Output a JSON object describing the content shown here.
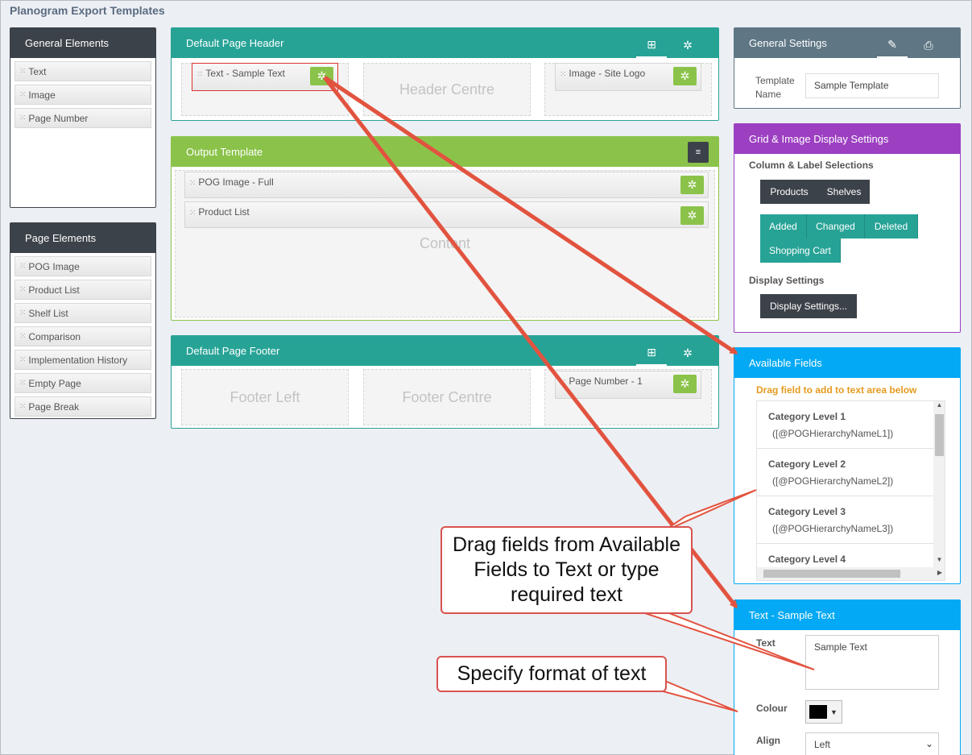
{
  "page_title": "Planogram Export Templates",
  "general_elements": {
    "title": "General Elements",
    "items": [
      "Text",
      "Image",
      "Page Number"
    ]
  },
  "page_elements": {
    "title": "Page Elements",
    "items": [
      "POG Image",
      "Product List",
      "Shelf List",
      "Comparison",
      "Implementation History",
      "Empty Page",
      "Page Break"
    ]
  },
  "header": {
    "title": "Default Page Header",
    "left_chip": "Text - Sample Text",
    "centre": "Header Centre",
    "right_chip": "Image - Site Logo"
  },
  "output": {
    "title": "Output Template",
    "items": [
      "POG Image - Full",
      "Product List"
    ],
    "content_label": "Content"
  },
  "footer": {
    "title": "Default Page Footer",
    "left": "Footer Left",
    "centre": "Footer Centre",
    "right_chip": "Page Number - 1"
  },
  "general_settings": {
    "title": "General Settings",
    "template_name_label": "Template Name",
    "template_name_value": "Sample Template"
  },
  "grid_settings": {
    "title": "Grid & Image Display Settings",
    "column_label": "Column & Label Selections",
    "dark_buttons": [
      "Products",
      "Shelves"
    ],
    "teal_buttons": [
      "Added",
      "Changed",
      "Deleted",
      "Shopping Cart"
    ],
    "display_label": "Display Settings",
    "display_button": "Display Settings..."
  },
  "available_fields": {
    "title": "Available Fields",
    "hint": "Drag field to add to text area below",
    "fields": [
      {
        "name": "Category Level 1",
        "code": "([@POGHierarchyNameL1])"
      },
      {
        "name": "Category Level 2",
        "code": "([@POGHierarchyNameL2])"
      },
      {
        "name": "Category Level 3",
        "code": "([@POGHierarchyNameL3])"
      },
      {
        "name": "Category Level 4",
        "code": ""
      }
    ]
  },
  "text_settings": {
    "title": "Text - Sample Text",
    "text_label": "Text",
    "text_value": "Sample Text",
    "colour_label": "Colour",
    "colour_value": "#000000",
    "align_label": "Align",
    "align_value": "Left"
  },
  "callouts": {
    "drag": "Drag fields from Available Fields to Text or type required text",
    "format": "Specify format of text"
  },
  "colors": {
    "dark": "#3c4249",
    "teal": "#27a396",
    "green": "#8bc34a",
    "slate": "#5f7784",
    "purple": "#9c3fc1",
    "blue": "#03a9f4",
    "arrow": "#e2533f",
    "hint": "#e59a1f"
  }
}
